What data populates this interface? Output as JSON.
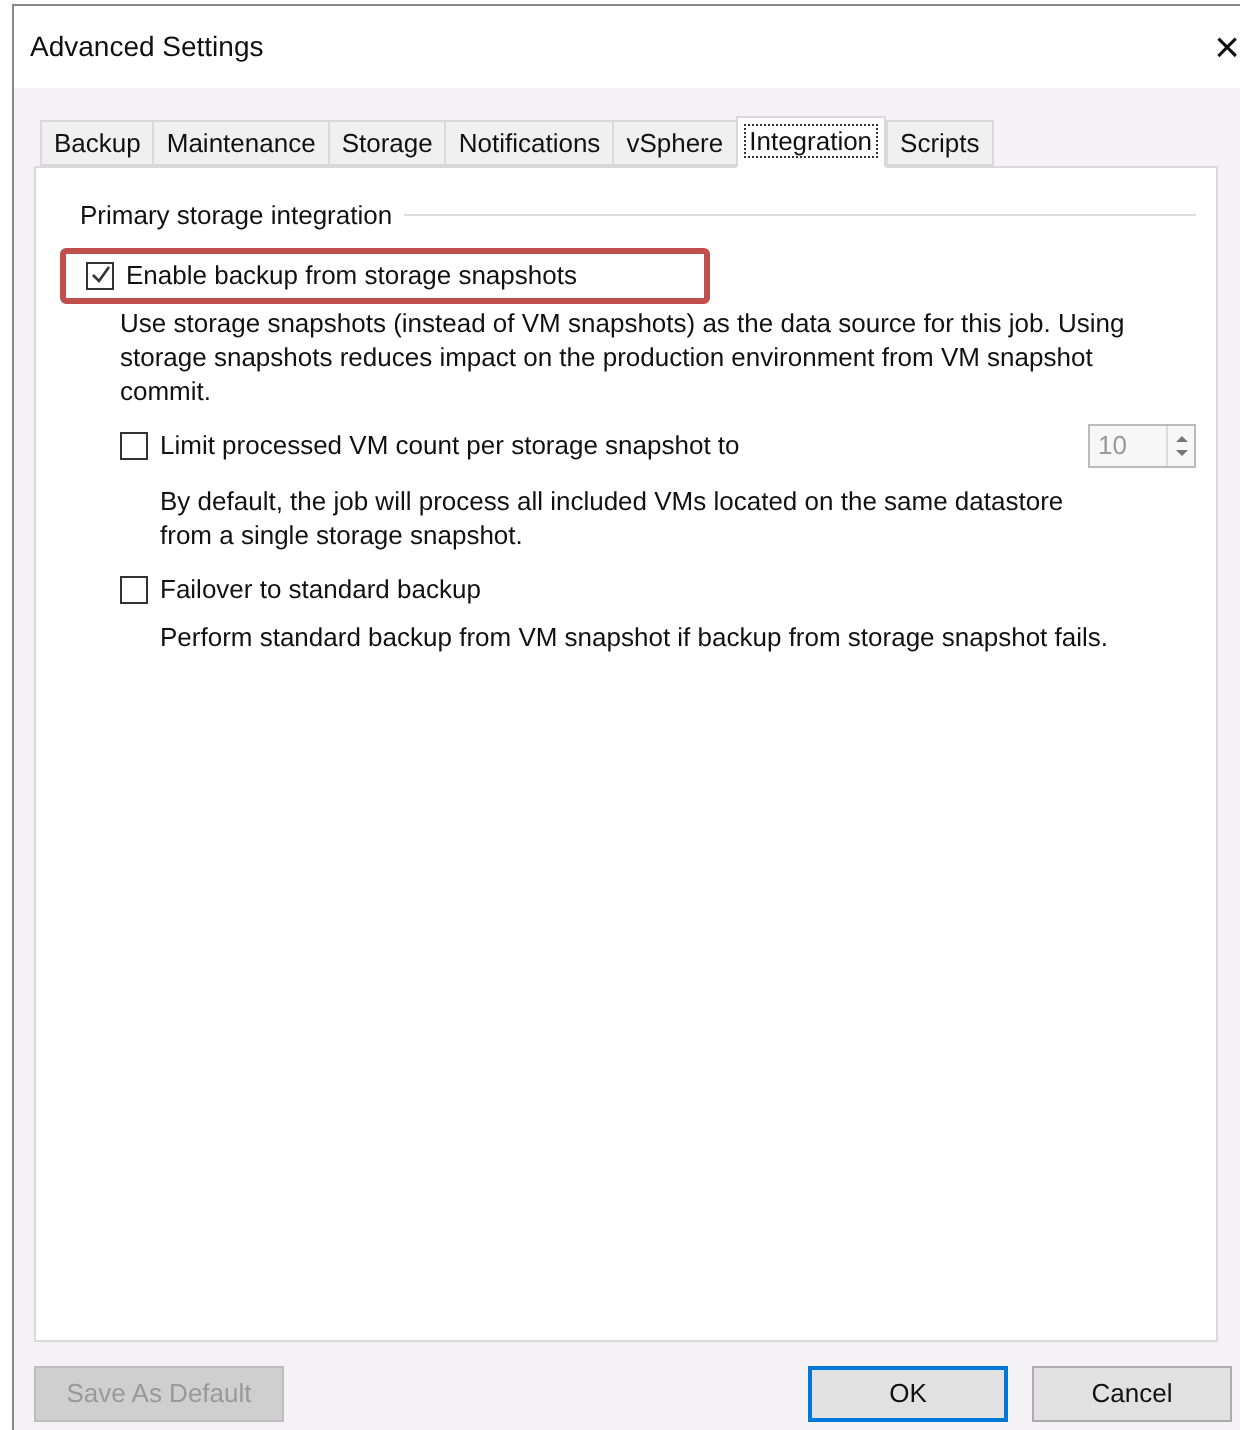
{
  "window": {
    "title": "Advanced Settings",
    "close": "×"
  },
  "tabs": [
    {
      "label": "Backup",
      "selected": false
    },
    {
      "label": "Maintenance",
      "selected": false
    },
    {
      "label": "Storage",
      "selected": false
    },
    {
      "label": "Notifications",
      "selected": false
    },
    {
      "label": "vSphere",
      "selected": false
    },
    {
      "label": "Integration",
      "selected": true
    },
    {
      "label": "Scripts",
      "selected": false
    }
  ],
  "group": {
    "title": "Primary storage integration",
    "options": [
      {
        "label": "Enable backup from storage snapshots",
        "checked": true,
        "highlighted": true,
        "description": "Use storage snapshots (instead of VM snapshots) as the data source for this job. Using storage snapshots reduces impact on the production environment from VM snapshot commit.",
        "children": [
          {
            "label": "Limit processed VM count per storage snapshot to",
            "checked": false,
            "highlighted": false,
            "spinner": {
              "value": "10",
              "disabled": true
            },
            "description": "By default, the job will process all included VMs located on the same datastore from a single storage snapshot."
          },
          {
            "label": "Failover to standard backup",
            "checked": false,
            "highlighted": false,
            "description": "Perform standard backup from VM snapshot if backup from storage snapshot fails."
          }
        ]
      }
    ]
  },
  "buttons": [
    {
      "kind": "save-default",
      "label": "Save As Default",
      "disabled": true,
      "default": false
    },
    {
      "kind": "ok",
      "label": "OK",
      "disabled": false,
      "default": true
    },
    {
      "kind": "cancel",
      "label": "Cancel",
      "disabled": false,
      "default": false
    }
  ]
}
